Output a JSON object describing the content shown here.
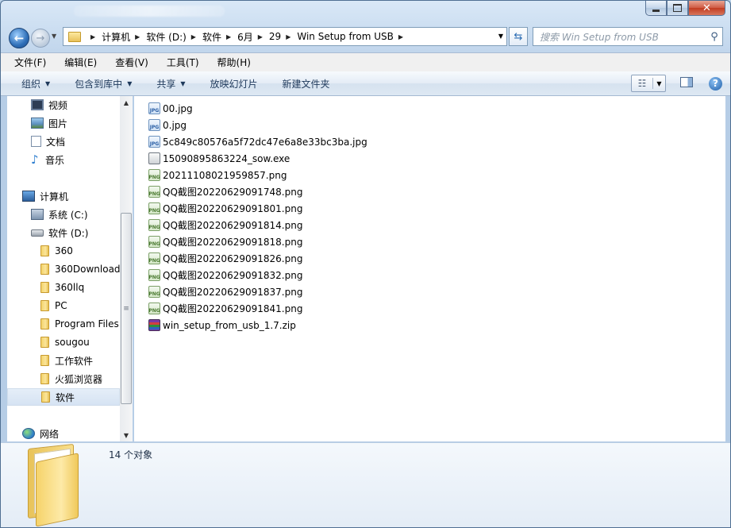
{
  "window": {
    "caption": {
      "minimize": "",
      "maximize": "",
      "close": "✕"
    }
  },
  "nav": {
    "back_glyph": "←",
    "forward_glyph": "→",
    "breadcrumbs": [
      "计算机",
      "软件 (D:)",
      "软件",
      "6月",
      "29",
      "Win Setup from USB"
    ],
    "search_placeholder": "搜索 Win Setup from USB"
  },
  "menu": [
    "文件(F)",
    "编辑(E)",
    "查看(V)",
    "工具(T)",
    "帮助(H)"
  ],
  "commands": {
    "organize": "组织",
    "include_in_library": "包含到库中",
    "share": "共享",
    "slideshow": "放映幻灯片",
    "new_folder": "新建文件夹"
  },
  "sidebar": {
    "libraries": [
      "视频",
      "图片",
      "文档",
      "音乐"
    ],
    "computer": "计算机",
    "drives": [
      "系统 (C:)",
      "软件 (D:)"
    ],
    "folders": [
      "360",
      "360Download",
      "360llq",
      "PC",
      "Program Files",
      "sougou",
      "工作软件",
      "火狐浏览器",
      "软件"
    ],
    "selected_folder": "软件",
    "network": "网络"
  },
  "files": [
    {
      "name": "00.jpg",
      "type": "jpg"
    },
    {
      "name": "0.jpg",
      "type": "jpg"
    },
    {
      "name": "5c849c80576a5f72dc47e6a8e33bc3ba.jpg",
      "type": "jpg"
    },
    {
      "name": "15090895863224_sow.exe",
      "type": "exe"
    },
    {
      "name": "20211108021959857.png",
      "type": "png"
    },
    {
      "name": "QQ截图20220629091748.png",
      "type": "png"
    },
    {
      "name": "QQ截图20220629091801.png",
      "type": "png"
    },
    {
      "name": "QQ截图20220629091814.png",
      "type": "png"
    },
    {
      "name": "QQ截图20220629091818.png",
      "type": "png"
    },
    {
      "name": "QQ截图20220629091826.png",
      "type": "png"
    },
    {
      "name": "QQ截图20220629091832.png",
      "type": "png"
    },
    {
      "name": "QQ截图20220629091837.png",
      "type": "png"
    },
    {
      "name": "QQ截图20220629091841.png",
      "type": "png"
    },
    {
      "name": "win_setup_from_usb_1.7.zip",
      "type": "zip"
    }
  ],
  "details": {
    "item_count": "14 个对象"
  },
  "icons": {
    "jpg": "JPG",
    "png": "PNG",
    "exe": "",
    "zip": ""
  }
}
